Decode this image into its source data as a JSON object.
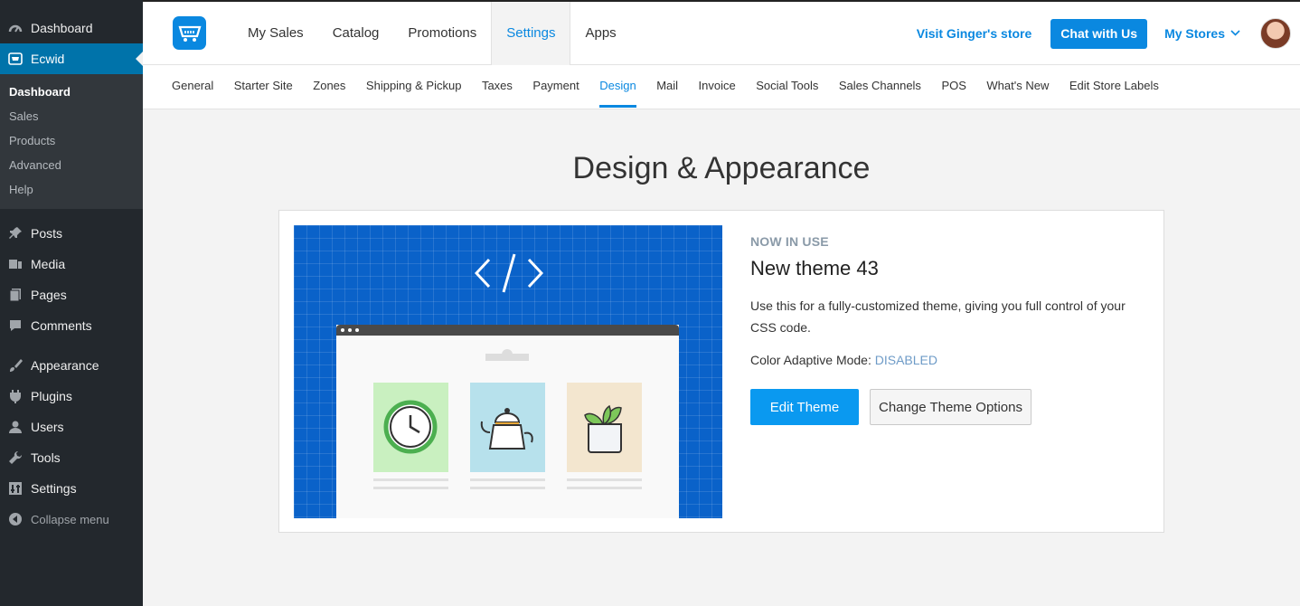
{
  "wp_sidebar": {
    "top_items": [
      {
        "label": "Dashboard",
        "icon": "dashboard-icon"
      },
      {
        "label": "Ecwid",
        "icon": "ecwid-cart-icon"
      }
    ],
    "ecwid_sub": [
      "Dashboard",
      "Sales",
      "Products",
      "Advanced",
      "Help"
    ],
    "items": [
      {
        "label": "Posts",
        "icon": "pin-icon"
      },
      {
        "label": "Media",
        "icon": "media-icon"
      },
      {
        "label": "Pages",
        "icon": "pages-icon"
      },
      {
        "label": "Comments",
        "icon": "comment-icon"
      },
      {
        "label": "Appearance",
        "icon": "brush-icon"
      },
      {
        "label": "Plugins",
        "icon": "plug-icon"
      },
      {
        "label": "Users",
        "icon": "user-icon"
      },
      {
        "label": "Tools",
        "icon": "wrench-icon"
      },
      {
        "label": "Settings",
        "icon": "sliders-icon"
      }
    ],
    "collapse": "Collapse menu"
  },
  "header": {
    "tabs": [
      "My Sales",
      "Catalog",
      "Promotions",
      "Settings",
      "Apps"
    ],
    "active_tab": "Settings",
    "visit_store": "Visit Ginger's store",
    "chat": "Chat with Us",
    "my_stores": "My Stores"
  },
  "subnav": {
    "tabs": [
      "General",
      "Starter Site",
      "Zones",
      "Shipping & Pickup",
      "Taxes",
      "Payment",
      "Design",
      "Mail",
      "Invoice",
      "Social Tools",
      "Sales Channels",
      "POS",
      "What's New",
      "Edit Store Labels"
    ],
    "active": "Design"
  },
  "page": {
    "title": "Design & Appearance",
    "status": "NOW IN USE",
    "theme_name": "New theme 43",
    "description": "Use this for a fully-customized theme, giving you full control of your CSS code.",
    "mode_label": "Color Adaptive Mode:",
    "mode_value": "DISABLED",
    "edit_button": "Edit Theme",
    "change_button": "Change Theme Options"
  },
  "colors": {
    "accent": "#0a88e0",
    "wp_sidebar": "#23282d",
    "wp_active": "#0073aa",
    "illustration_bg": "#0a62c9"
  }
}
